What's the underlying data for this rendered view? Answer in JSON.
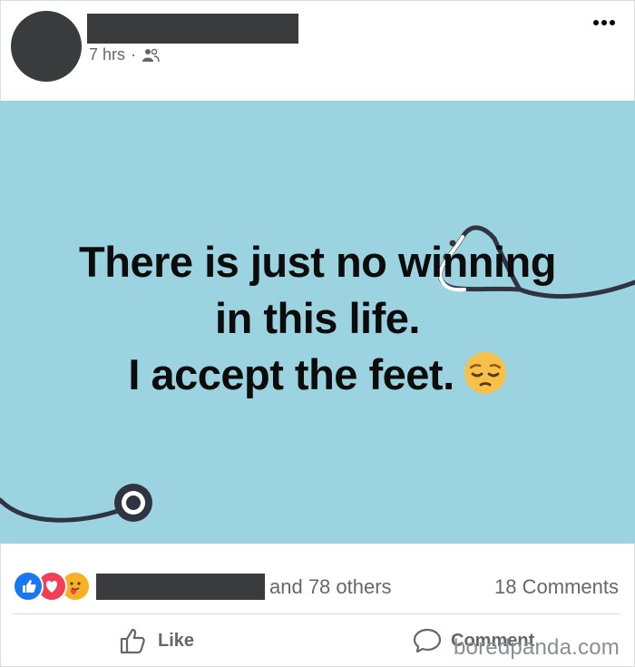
{
  "post": {
    "time": "7 hrs",
    "separator": "·",
    "audience_icon": "friends-icon",
    "more_icon": "more-options-icon",
    "text_lines": [
      "There is just no winning",
      "in this life.",
      "I accept the feet."
    ],
    "emoji": "pensive-face-emoji",
    "background_color": "#9bd4e0"
  },
  "engagement": {
    "reactions": [
      "like",
      "love",
      "care"
    ],
    "others_text": "and 78 others",
    "comments_text": "18 Comments"
  },
  "actions": {
    "like_label": "Like",
    "comment_label": "Comment"
  },
  "watermark": "boredpanda.com"
}
